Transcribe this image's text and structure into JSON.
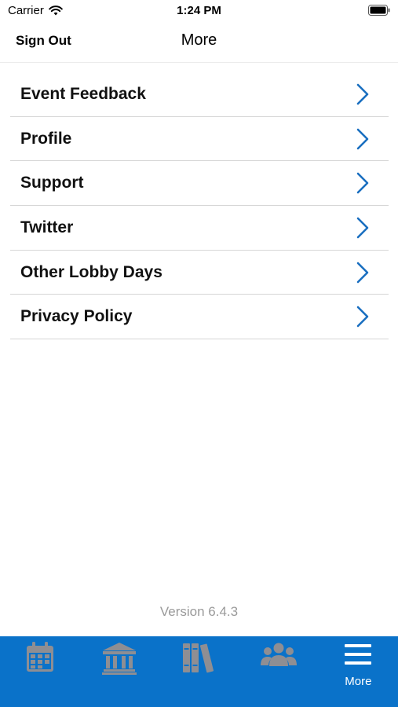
{
  "status_bar": {
    "carrier": "Carrier",
    "time": "1:24 PM"
  },
  "nav": {
    "left_button": "Sign Out",
    "title": "More"
  },
  "menu": {
    "items": [
      {
        "label": "Event Feedback"
      },
      {
        "label": "Profile"
      },
      {
        "label": "Support"
      },
      {
        "label": "Twitter"
      },
      {
        "label": "Other Lobby Days"
      },
      {
        "label": "Privacy Policy"
      }
    ]
  },
  "footer": {
    "version": "Version 6.4.3"
  },
  "tab_bar": {
    "tabs": [
      {
        "icon": "calendar-icon",
        "label": ""
      },
      {
        "icon": "capitol-building-icon",
        "label": ""
      },
      {
        "icon": "library-books-icon",
        "label": ""
      },
      {
        "icon": "people-group-icon",
        "label": ""
      },
      {
        "icon": "menu-hamburger-icon",
        "label": "More"
      }
    ]
  },
  "colors": {
    "accent": "#0a72c9",
    "chevron": "#1a6fc0",
    "inactive_tab_icon": "#8e8e93",
    "active_tab_icon": "#ffffff"
  }
}
